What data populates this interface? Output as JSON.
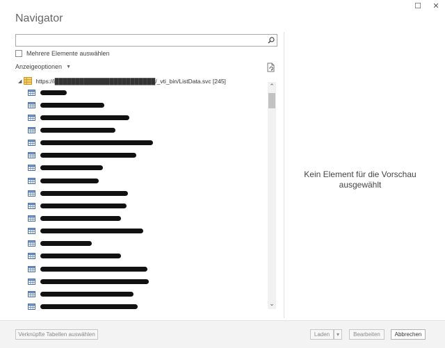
{
  "window": {
    "title": "Navigator",
    "controls": {
      "maximize": "☐",
      "close": "✕"
    }
  },
  "search": {
    "value": "",
    "placeholder": ""
  },
  "multi_select": {
    "label": "Mehrere Elemente auswählen",
    "checked": false
  },
  "display_options": {
    "label": "Anzeigeoptionen",
    "caret": "▼"
  },
  "tree": {
    "root_label": "https://i████████████████████████/_vti_bin/ListData.svc [245]",
    "items": [
      {
        "redacted_width": 38
      },
      {
        "redacted_width": 92
      },
      {
        "redacted_width": 128
      },
      {
        "redacted_width": 108
      },
      {
        "redacted_width": 162
      },
      {
        "redacted_width": 138
      },
      {
        "redacted_width": 90
      },
      {
        "redacted_width": 84
      },
      {
        "redacted_width": 126
      },
      {
        "redacted_width": 124
      },
      {
        "redacted_width": 116
      },
      {
        "redacted_width": 148
      },
      {
        "redacted_width": 74
      },
      {
        "redacted_width": 116
      },
      {
        "redacted_width": 154
      },
      {
        "redacted_width": 156
      },
      {
        "redacted_width": 134
      },
      {
        "redacted_width": 140
      }
    ]
  },
  "preview": {
    "message": "Kein Element für die Vorschau ausgewählt"
  },
  "footer": {
    "linked_tables_label": "Verknüpfte Tabellen auswählen",
    "load_label": "Laden",
    "load_caret": "▾",
    "edit_label": "Bearbeiten",
    "cancel_label": "Abbrechen"
  },
  "colors": {
    "accent": "#217346",
    "redaction": "#111111",
    "db_icon": "#e6a817"
  }
}
